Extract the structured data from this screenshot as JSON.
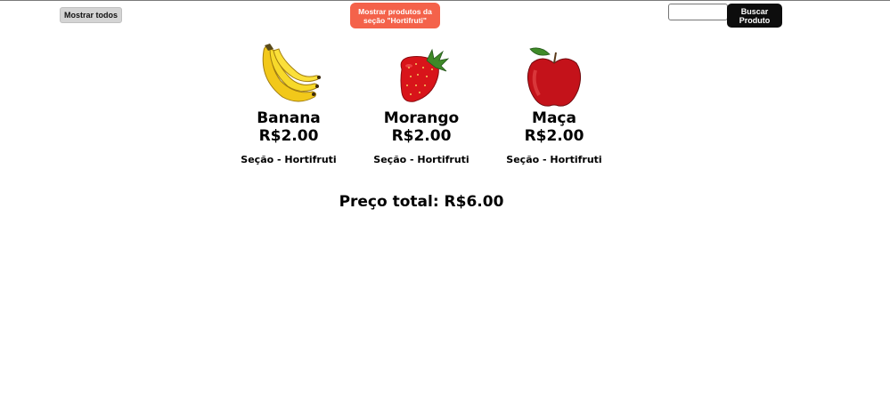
{
  "toolbar": {
    "show_all_label": "Mostrar todos",
    "section_button_label": "Mostrar produtos da\nseção \"Hortifruti\"",
    "search_placeholder": "",
    "search_value": "",
    "search_button_label": "Buscar\nProduto",
    "section_button_color": "#f4624a",
    "search_button_color": "#0d0d0d"
  },
  "products": [
    {
      "name": "Banana",
      "price": "R$2.00",
      "section": "Seção - Hortifruti",
      "image": "banana-image"
    },
    {
      "name": "Morango",
      "price": "R$2.00",
      "section": "Seção - Hortifruti",
      "image": "strawberry-image"
    },
    {
      "name": "Maça",
      "price": "R$2.00",
      "section": "Seção - Hortifruti",
      "image": "apple-image"
    }
  ],
  "total_label": "Preço total: R$6.00"
}
